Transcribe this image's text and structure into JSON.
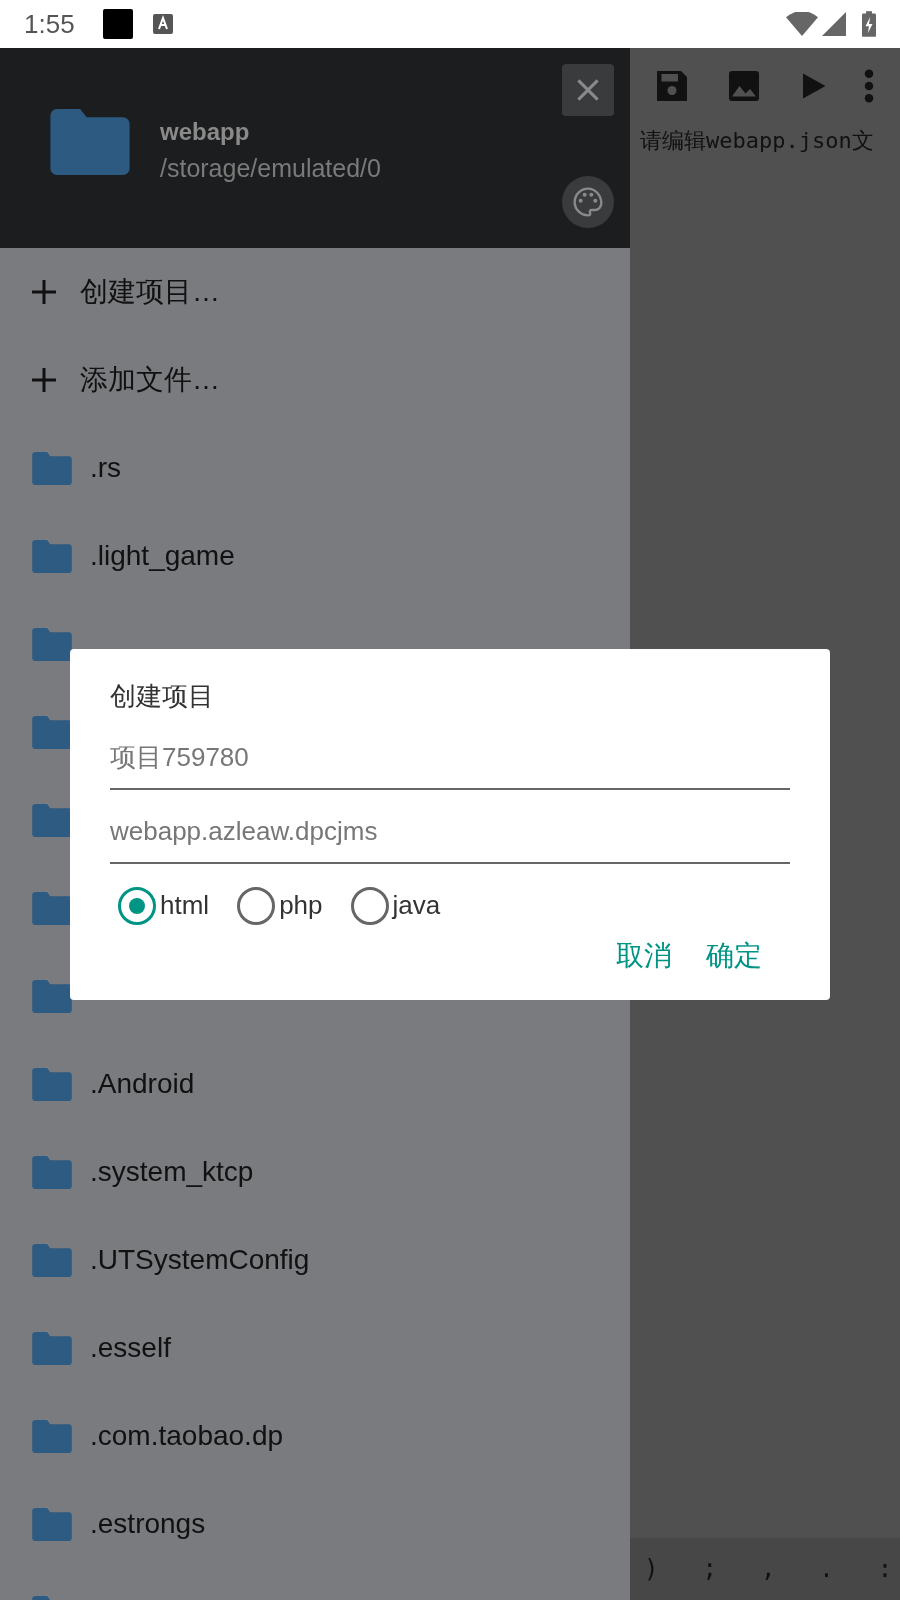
{
  "status_bar": {
    "time": "1:55"
  },
  "drawer": {
    "header": {
      "title": "webapp",
      "path": "/storage/emulated/0"
    },
    "actions": [
      {
        "label": "创建项目…"
      },
      {
        "label": "添加文件…"
      }
    ],
    "folders": [
      {
        "name": ".rs"
      },
      {
        "name": ".light_game"
      },
      {
        "kind": "covered"
      },
      {
        "kind": "covered"
      },
      {
        "kind": "covered"
      },
      {
        "kind": "covered"
      },
      {
        "kind": "covered"
      },
      {
        "name": ".Android"
      },
      {
        "name": ".system_ktcp"
      },
      {
        "name": ".UTSystemConfig"
      },
      {
        "name": ".esself"
      },
      {
        "name": ".com.taobao.dp"
      },
      {
        "name": ".estrongs"
      },
      {
        "kind": "covered"
      }
    ]
  },
  "editor": {
    "text": "请编辑webapp.json文",
    "symbols": [
      ")",
      ";",
      ",",
      ".",
      ":"
    ]
  },
  "dialog": {
    "title": "创建项目",
    "fields": [
      {
        "placeholder": "项目759780"
      },
      {
        "placeholder": "webapp.azleaw.dpcjms"
      }
    ],
    "radios": [
      {
        "label": "html",
        "selected": true
      },
      {
        "label": "php",
        "selected": false
      },
      {
        "label": "java",
        "selected": false
      }
    ],
    "buttons": [
      "取消",
      "确定"
    ]
  }
}
